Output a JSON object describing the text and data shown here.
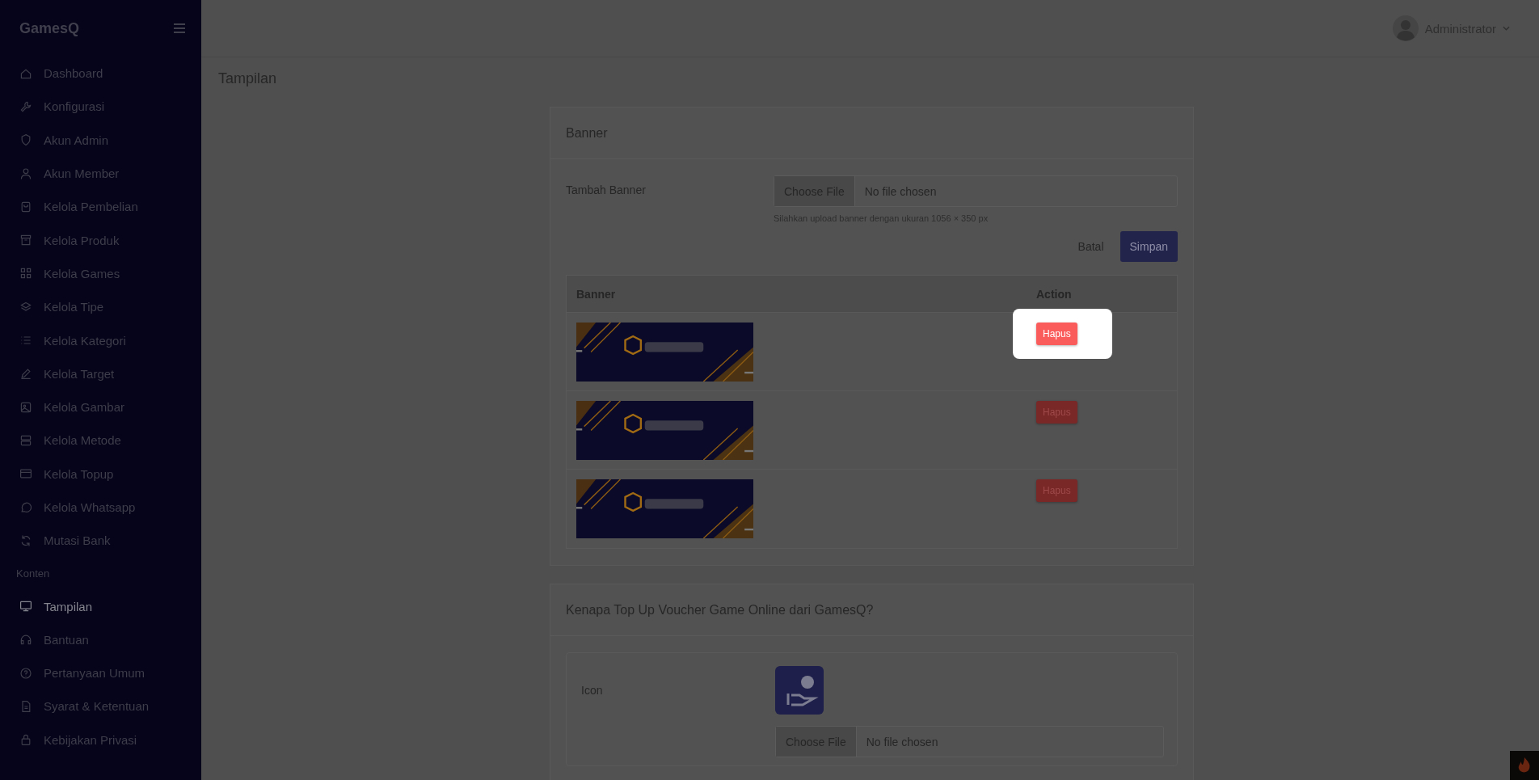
{
  "brand": "GamesQ",
  "sidebar": {
    "items": [
      {
        "label": "Dashboard",
        "selected": false
      },
      {
        "label": "Konfigurasi",
        "selected": false
      },
      {
        "label": "Akun Admin",
        "selected": false
      },
      {
        "label": "Akun Member",
        "selected": false
      },
      {
        "label": "Kelola Pembelian",
        "selected": false
      },
      {
        "label": "Kelola Produk",
        "selected": false
      },
      {
        "label": "Kelola Games",
        "selected": false
      },
      {
        "label": "Kelola Tipe",
        "selected": false
      },
      {
        "label": "Kelola Kategori",
        "selected": false
      },
      {
        "label": "Kelola Target",
        "selected": false
      },
      {
        "label": "Kelola Gambar",
        "selected": false
      },
      {
        "label": "Kelola Metode",
        "selected": false
      },
      {
        "label": "Kelola Topup",
        "selected": false
      },
      {
        "label": "Kelola Whatsapp",
        "selected": false
      },
      {
        "label": "Mutasi Bank",
        "selected": false
      }
    ],
    "section": "Konten",
    "section_items": [
      {
        "label": "Tampilan",
        "selected": true
      },
      {
        "label": "Bantuan",
        "selected": false
      },
      {
        "label": "Pertanyaan Umum",
        "selected": false
      },
      {
        "label": "Syarat & Ketentuan",
        "selected": false
      },
      {
        "label": "Kebijakan Privasi",
        "selected": false
      }
    ]
  },
  "header": {
    "user": "Administrator"
  },
  "page_title": "Tampilan",
  "banner_card": {
    "title": "Banner",
    "field_label": "Tambah Banner",
    "file_button": "Choose File",
    "file_value": "No file chosen",
    "hint": "Silahkan upload banner dengan ukuran 1056 × 350 px",
    "cancel": "Batal",
    "save": "Simpan",
    "table": {
      "columns": [
        "Banner",
        "Action"
      ],
      "rows": [
        {
          "action": "Hapus",
          "highlighted": true
        },
        {
          "action": "Hapus",
          "highlighted": false
        },
        {
          "action": "Hapus",
          "highlighted": false
        }
      ]
    }
  },
  "why_card": {
    "title": "Kenapa Top Up Voucher Game Online dari GamesQ?",
    "field_label": "Icon",
    "file_button": "Choose File",
    "file_value": "No file chosen"
  }
}
